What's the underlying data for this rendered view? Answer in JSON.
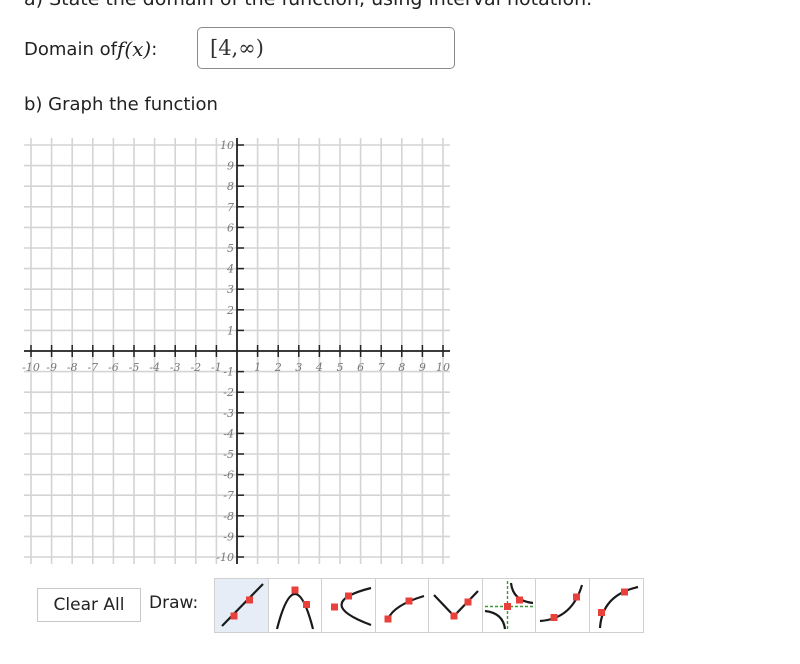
{
  "question": {
    "part_a_text": "a) State the domain of the function, using interval notation.",
    "domain_label_prefix": "Domain of ",
    "domain_label_fn": "f",
    "domain_label_arg": "(x)",
    "domain_label_suffix": " :",
    "domain_value": "[4,∞)",
    "part_b_text": "b) Graph the function"
  },
  "graph": {
    "x_range": [
      -10,
      10
    ],
    "y_range": [
      -10,
      10
    ],
    "x_tick_labels": [
      "-10",
      "-9",
      "-8",
      "-7",
      "-6",
      "-5",
      "-4",
      "-3",
      "-2",
      "-1",
      "1",
      "2",
      "3",
      "4",
      "5",
      "6",
      "7",
      "8",
      "9",
      "10"
    ],
    "y_tick_labels": [
      "10",
      "9",
      "8",
      "7",
      "6",
      "5",
      "4",
      "3",
      "2",
      "1",
      "-1",
      "-2",
      "-3",
      "-4",
      "-5",
      "-6",
      "-7",
      "-8",
      "-9",
      "-10"
    ],
    "grid_color": "#d4d4d4",
    "axis_color": "#222222"
  },
  "toolbar": {
    "clear_label": "Clear All",
    "draw_label": "Draw:",
    "tools": [
      {
        "name": "line-tool",
        "icon": "line-icon",
        "active": true
      },
      {
        "name": "parabola-tool",
        "icon": "parabola-icon",
        "active": false
      },
      {
        "name": "sideways-parabola-tool",
        "icon": "sideways-parabola-icon",
        "active": false
      },
      {
        "name": "square-root-tool",
        "icon": "square-root-icon",
        "active": false
      },
      {
        "name": "absolute-value-tool",
        "icon": "absolute-value-icon",
        "active": false
      },
      {
        "name": "rational-tool",
        "icon": "rational-icon",
        "active": false
      },
      {
        "name": "exponential-tool",
        "icon": "exponential-icon",
        "active": false
      },
      {
        "name": "logarithm-tool",
        "icon": "logarithm-icon",
        "active": false
      }
    ],
    "point_color": "#e8413c"
  }
}
